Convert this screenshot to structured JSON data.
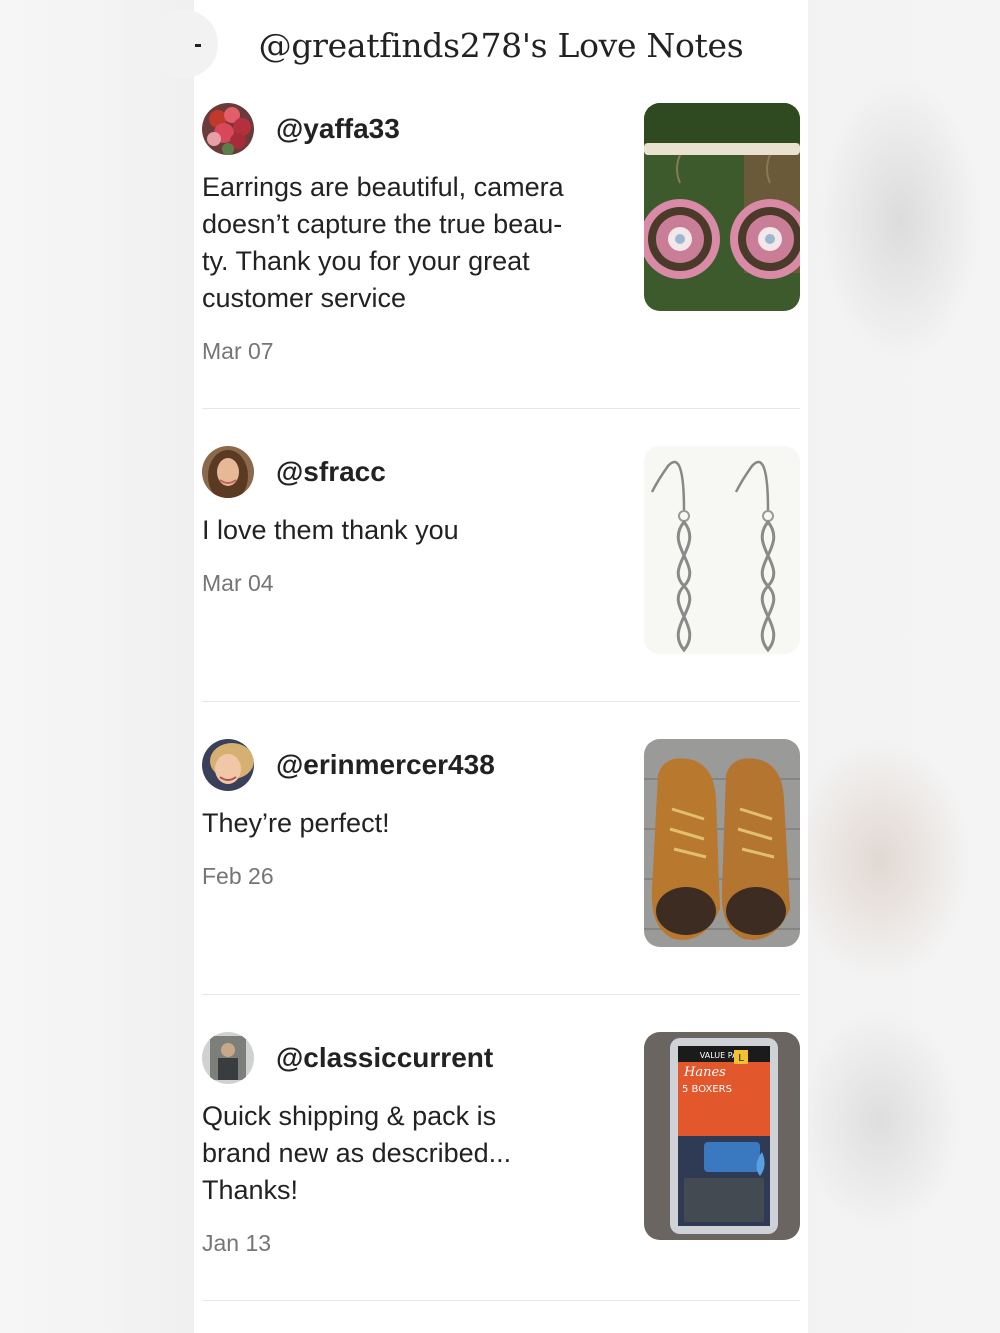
{
  "header": {
    "title": "@greatfinds278's Love Notes"
  },
  "notes": [
    {
      "username": "@yaffa33",
      "lines": [
        "Earrings are beautiful, camera",
        "doesn’t capture the true beau-",
        "ty. Thank you for your great",
        "customer service"
      ],
      "date": "Mar 07",
      "avatar_icon": "flower-bouquet",
      "thumbnail": "pink-medallion-earrings"
    },
    {
      "username": "@sfracc",
      "lines": [
        "I love them thank you"
      ],
      "date": "Mar 04",
      "avatar_icon": "woman-portrait",
      "thumbnail": "silver-infinity-earrings"
    },
    {
      "username": "@erinmercer438",
      "lines": [
        "They’re perfect!"
      ],
      "date": "Feb 26",
      "avatar_icon": "woman-selfie",
      "thumbnail": "tan-work-boots"
    },
    {
      "username": "@classiccurrent",
      "lines": [
        "Quick shipping & pack is",
        "brand new as described...",
        "Thanks!"
      ],
      "date": "Jan 13",
      "avatar_icon": "man-portrait",
      "thumbnail": "hanes-boxers-pack"
    }
  ],
  "product_labels": {
    "brand": "Hanes",
    "count": "5 BOXERS",
    "size": "L",
    "pack": "VALUE PACK"
  },
  "colors": {
    "panel": "#ffffff",
    "text": "#222222",
    "date": "#757575",
    "divider": "#e6e6e6"
  }
}
